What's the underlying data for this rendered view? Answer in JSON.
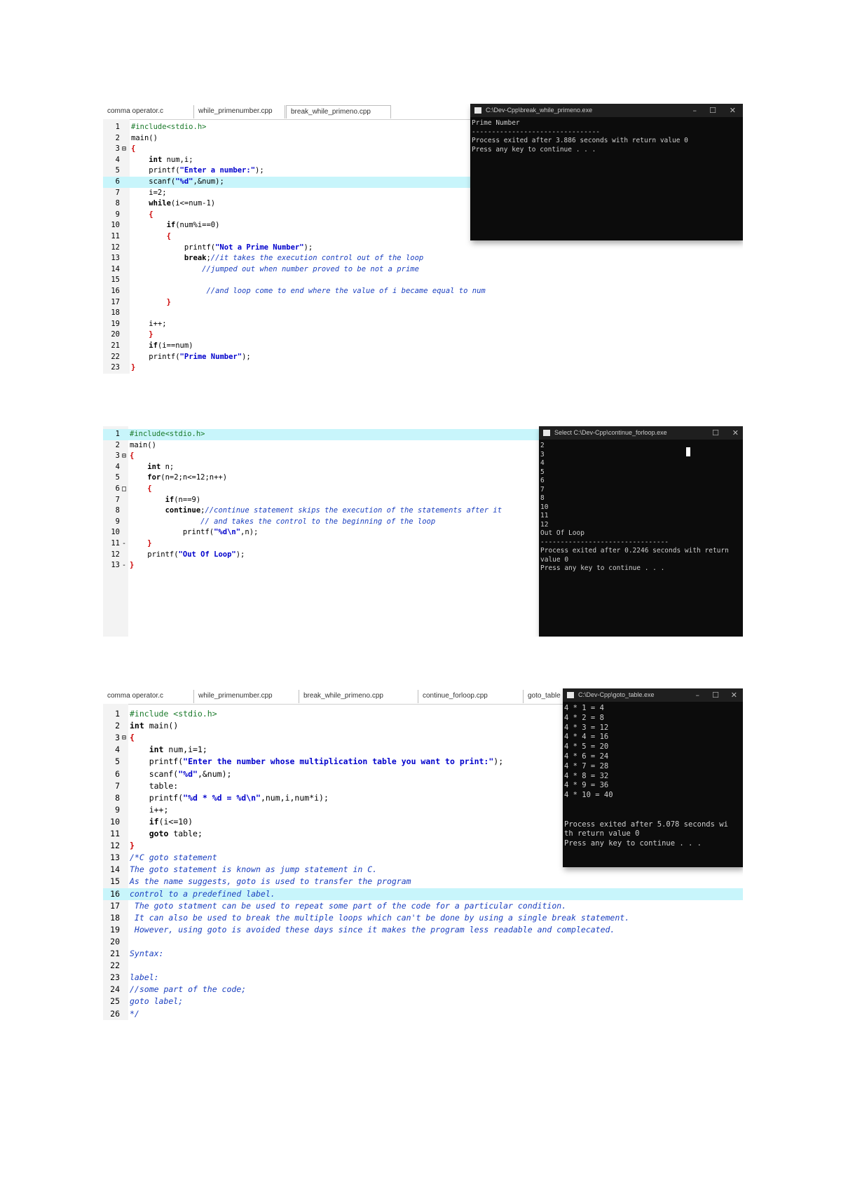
{
  "panel1": {
    "tabs": [
      "comma operator.c",
      "while_primenumber.cpp",
      "break_while_primeno.cpp"
    ],
    "lines": [
      {
        "n": "1",
        "fold": "",
        "segs": [
          [
            "pp",
            "#include<stdio.h>"
          ]
        ]
      },
      {
        "n": "2",
        "fold": "",
        "segs": [
          [
            "plain",
            "main()"
          ]
        ]
      },
      {
        "n": "3",
        "fold": "⊟",
        "segs": [
          [
            "br",
            "{"
          ]
        ]
      },
      {
        "n": "4",
        "fold": "",
        "segs": [
          [
            "plain",
            "    "
          ],
          [
            "kw",
            "int"
          ],
          [
            "plain",
            " num,i;"
          ]
        ]
      },
      {
        "n": "5",
        "fold": "",
        "segs": [
          [
            "plain",
            "    printf("
          ],
          [
            "str",
            "\"Enter a number:\""
          ],
          [
            "plain",
            ");"
          ]
        ]
      },
      {
        "n": "6",
        "fold": "",
        "hl": true,
        "segs": [
          [
            "plain",
            "    scanf("
          ],
          [
            "str",
            "\"%d\""
          ],
          [
            "plain",
            ",&num);"
          ]
        ]
      },
      {
        "n": "7",
        "fold": "",
        "segs": [
          [
            "plain",
            "    i=2;"
          ]
        ]
      },
      {
        "n": "8",
        "fold": "",
        "segs": [
          [
            "plain",
            "    "
          ],
          [
            "kw",
            "while"
          ],
          [
            "plain",
            "(i<=num-1)"
          ]
        ]
      },
      {
        "n": "9",
        "fold": "",
        "segs": [
          [
            "plain",
            "    "
          ],
          [
            "br",
            "{"
          ]
        ]
      },
      {
        "n": "10",
        "fold": "",
        "segs": [
          [
            "plain",
            "        "
          ],
          [
            "kw",
            "if"
          ],
          [
            "plain",
            "(num%i==0)"
          ]
        ]
      },
      {
        "n": "11",
        "fold": "",
        "segs": [
          [
            "plain",
            "        "
          ],
          [
            "br",
            "{"
          ]
        ]
      },
      {
        "n": "12",
        "fold": "",
        "segs": [
          [
            "plain",
            "            printf("
          ],
          [
            "str",
            "\"Not a Prime Number\""
          ],
          [
            "plain",
            ");"
          ]
        ]
      },
      {
        "n": "13",
        "fold": "",
        "segs": [
          [
            "plain",
            "            "
          ],
          [
            "kw",
            "break"
          ],
          [
            "plain",
            ";"
          ],
          [
            "cm",
            "//it takes the execution control out of the loop"
          ]
        ]
      },
      {
        "n": "14",
        "fold": "",
        "segs": [
          [
            "plain",
            "                "
          ],
          [
            "cm",
            "//jumped out when number proved to be not a prime"
          ]
        ]
      },
      {
        "n": "15",
        "fold": "",
        "segs": [
          [
            "plain",
            ""
          ]
        ]
      },
      {
        "n": "16",
        "fold": "",
        "segs": [
          [
            "plain",
            "                 "
          ],
          [
            "cm",
            "//and loop come to end where the value of i became equal to num"
          ]
        ]
      },
      {
        "n": "17",
        "fold": "",
        "segs": [
          [
            "plain",
            "        "
          ],
          [
            "br",
            "}"
          ]
        ]
      },
      {
        "n": "18",
        "fold": "",
        "segs": [
          [
            "plain",
            ""
          ]
        ]
      },
      {
        "n": "19",
        "fold": "",
        "segs": [
          [
            "plain",
            "    i++;"
          ]
        ]
      },
      {
        "n": "20",
        "fold": "",
        "segs": [
          [
            "plain",
            "    "
          ],
          [
            "br",
            "}"
          ]
        ]
      },
      {
        "n": "21",
        "fold": "",
        "segs": [
          [
            "plain",
            "    "
          ],
          [
            "kw",
            "if"
          ],
          [
            "plain",
            "(i==num)"
          ]
        ]
      },
      {
        "n": "22",
        "fold": "",
        "segs": [
          [
            "plain",
            "    printf("
          ],
          [
            "str",
            "\"Prime Number\""
          ],
          [
            "plain",
            ");"
          ]
        ]
      },
      {
        "n": "23",
        "fold": "",
        "segs": [
          [
            "br",
            "}"
          ]
        ]
      }
    ],
    "console": {
      "title": "C:\\Dev-Cpp\\break_while_primeno.exe",
      "text": "Prime Number\n--------------------------------\nProcess exited after 3.886 seconds with return value 0\nPress any key to continue . . ."
    }
  },
  "panel2": {
    "lines": [
      {
        "n": "1",
        "fold": "",
        "hl": true,
        "segs": [
          [
            "pp",
            "#include<stdio.h>"
          ]
        ]
      },
      {
        "n": "2",
        "fold": "",
        "segs": [
          [
            "plain",
            "main()"
          ]
        ]
      },
      {
        "n": "3",
        "fold": "⊟",
        "segs": [
          [
            "br",
            "{"
          ]
        ]
      },
      {
        "n": "4",
        "fold": "",
        "segs": [
          [
            "plain",
            "    "
          ],
          [
            "kw",
            "int"
          ],
          [
            "plain",
            " n;"
          ]
        ]
      },
      {
        "n": "5",
        "fold": "",
        "segs": [
          [
            "plain",
            "    "
          ],
          [
            "kw",
            "for"
          ],
          [
            "plain",
            "(n=2;n<=12;n++)"
          ]
        ]
      },
      {
        "n": "6",
        "fold": "□",
        "segs": [
          [
            "plain",
            "    "
          ],
          [
            "br",
            "{"
          ]
        ]
      },
      {
        "n": "7",
        "fold": "",
        "segs": [
          [
            "plain",
            "        "
          ],
          [
            "kw",
            "if"
          ],
          [
            "plain",
            "(n==9)"
          ]
        ]
      },
      {
        "n": "8",
        "fold": "",
        "segs": [
          [
            "plain",
            "        "
          ],
          [
            "kw",
            "continue"
          ],
          [
            "plain",
            ";"
          ],
          [
            "cm",
            "//continue statement skips the execution of the statements after it"
          ]
        ]
      },
      {
        "n": "9",
        "fold": "",
        "segs": [
          [
            "plain",
            "                "
          ],
          [
            "cm",
            "// and takes the control to the beginning of the loop"
          ]
        ]
      },
      {
        "n": "10",
        "fold": "",
        "segs": [
          [
            "plain",
            "            printf("
          ],
          [
            "str",
            "\"%d\\n\""
          ],
          [
            "plain",
            ",n);"
          ]
        ]
      },
      {
        "n": "11",
        "fold": "-",
        "segs": [
          [
            "plain",
            "    "
          ],
          [
            "br",
            "}"
          ]
        ]
      },
      {
        "n": "12",
        "fold": "",
        "segs": [
          [
            "plain",
            "    printf("
          ],
          [
            "str",
            "\"Out Of Loop\""
          ],
          [
            "plain",
            ");"
          ]
        ]
      },
      {
        "n": "13",
        "fold": "-",
        "segs": [
          [
            "br",
            "}"
          ]
        ]
      }
    ],
    "console": {
      "title": "Select C:\\Dev-Cpp\\continue_forloop.exe",
      "text": "2\n3\n4\n5\n6\n7\n8\n10\n11\n12\nOut Of Loop\n--------------------------------\nProcess exited after 0.2246 seconds with return\nvalue 0\nPress any key to continue . . ."
    }
  },
  "panel3": {
    "tabs": [
      "comma operator.c",
      "while_primenumber.cpp",
      "break_while_primeno.cpp",
      "continue_forloop.cpp",
      "goto_table"
    ],
    "lines": [
      {
        "n": "1",
        "fold": "",
        "segs": [
          [
            "pp",
            "#include <stdio.h>"
          ]
        ]
      },
      {
        "n": "2",
        "fold": "",
        "segs": [
          [
            "kw",
            "int"
          ],
          [
            "plain",
            " main()"
          ]
        ]
      },
      {
        "n": "3",
        "fold": "⊟",
        "segs": [
          [
            "br",
            "{"
          ]
        ]
      },
      {
        "n": "4",
        "fold": "",
        "segs": [
          [
            "plain",
            "    "
          ],
          [
            "kw",
            "int"
          ],
          [
            "plain",
            " num,i=1;"
          ]
        ]
      },
      {
        "n": "5",
        "fold": "",
        "segs": [
          [
            "plain",
            "    printf("
          ],
          [
            "str",
            "\"Enter the number whose multiplication table you want to print:\""
          ],
          [
            "plain",
            ");"
          ]
        ]
      },
      {
        "n": "6",
        "fold": "",
        "segs": [
          [
            "plain",
            "    scanf("
          ],
          [
            "str",
            "\"%d\""
          ],
          [
            "plain",
            ",&num);"
          ]
        ]
      },
      {
        "n": "7",
        "fold": "",
        "segs": [
          [
            "plain",
            "    table:"
          ]
        ]
      },
      {
        "n": "8",
        "fold": "",
        "segs": [
          [
            "plain",
            "    printf("
          ],
          [
            "str",
            "\"%d * %d = %d\\n\""
          ],
          [
            "plain",
            ",num,i,num*i);"
          ]
        ]
      },
      {
        "n": "9",
        "fold": "",
        "segs": [
          [
            "plain",
            "    i++;"
          ]
        ]
      },
      {
        "n": "10",
        "fold": "",
        "segs": [
          [
            "plain",
            "    "
          ],
          [
            "kw",
            "if"
          ],
          [
            "plain",
            "(i<=10)"
          ]
        ]
      },
      {
        "n": "11",
        "fold": "",
        "segs": [
          [
            "plain",
            "    "
          ],
          [
            "kw",
            "goto"
          ],
          [
            "plain",
            " table;"
          ]
        ]
      },
      {
        "n": "12",
        "fold": "",
        "segs": [
          [
            "br",
            "}"
          ]
        ]
      },
      {
        "n": "13",
        "fold": "",
        "segs": [
          [
            "cm",
            "/*C goto statement"
          ]
        ]
      },
      {
        "n": "14",
        "fold": "",
        "segs": [
          [
            "cm",
            "The goto statement is known as jump statement in C."
          ]
        ]
      },
      {
        "n": "15",
        "fold": "",
        "segs": [
          [
            "cm",
            "As the name suggests, goto is used to transfer the program"
          ]
        ]
      },
      {
        "n": "16",
        "fold": "",
        "hl": true,
        "segs": [
          [
            "cm",
            "control to a predefined label."
          ]
        ]
      },
      {
        "n": "17",
        "fold": "",
        "segs": [
          [
            "cm",
            " The goto statment can be used to repeat some part of the code for a particular condition."
          ]
        ]
      },
      {
        "n": "18",
        "fold": "",
        "segs": [
          [
            "cm",
            " It can also be used to break the multiple loops which can't be done by using a single break statement."
          ]
        ]
      },
      {
        "n": "19",
        "fold": "",
        "segs": [
          [
            "cm",
            " However, using goto is avoided these days since it makes the program less readable and complecated."
          ]
        ]
      },
      {
        "n": "20",
        "fold": "",
        "segs": [
          [
            "plain",
            ""
          ]
        ]
      },
      {
        "n": "21",
        "fold": "",
        "segs": [
          [
            "cm",
            "Syntax:"
          ]
        ]
      },
      {
        "n": "22",
        "fold": "",
        "segs": [
          [
            "plain",
            ""
          ]
        ]
      },
      {
        "n": "23",
        "fold": "",
        "segs": [
          [
            "cm",
            "label:"
          ]
        ]
      },
      {
        "n": "24",
        "fold": "",
        "segs": [
          [
            "cm",
            "//some part of the code;"
          ]
        ]
      },
      {
        "n": "25",
        "fold": "",
        "segs": [
          [
            "cm",
            "goto label;"
          ]
        ]
      },
      {
        "n": "26",
        "fold": "",
        "segs": [
          [
            "cm",
            "*/"
          ]
        ]
      }
    ],
    "console": {
      "title": "C:\\Dev-Cpp\\goto_table.exe",
      "text": "4 * 1 = 4\n4 * 2 = 8\n4 * 3 = 12\n4 * 4 = 16\n4 * 5 = 20\n4 * 6 = 24\n4 * 7 = 28\n4 * 8 = 32\n4 * 9 = 36\n4 * 10 = 40\n\n\nProcess exited after 5.078 seconds wi\nth return value 0\nPress any key to continue . . ."
    }
  },
  "colors": {
    "highlight": "#c8f5fb",
    "keyword": "#000000",
    "string": "#0000cc",
    "comment": "#1a3fbf",
    "preprocessor": "#1a7a2a",
    "brace": "#cc0000",
    "console_bg": "#0c0c0c"
  }
}
